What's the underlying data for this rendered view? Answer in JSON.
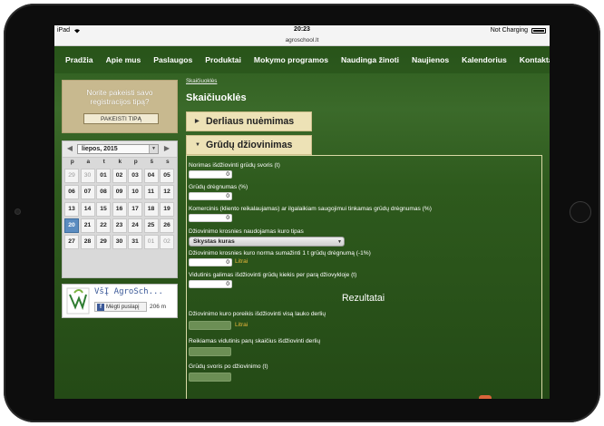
{
  "status_bar": {
    "device": "iPad",
    "time": "20:23",
    "battery": "Not Charging",
    "url": "agroschool.lt"
  },
  "nav": {
    "items": [
      "Pradžia",
      "Apie mus",
      "Paslaugos",
      "Produktai",
      "Mokymo programos",
      "Naudinga žinoti",
      "Naujienos",
      "Kalendorius",
      "Kontaktai"
    ]
  },
  "promo": {
    "text_line1": "Norite pakeisti savo",
    "text_line2": "registracijos tipą?",
    "button": "PAKEISTI TIPĄ"
  },
  "calendar": {
    "month": "liepos, 2015",
    "dow": [
      "p",
      "a",
      "t",
      "k",
      "p",
      "š",
      "s"
    ],
    "weeks": [
      [
        "29",
        "30",
        "01",
        "02",
        "03",
        "04",
        "05"
      ],
      [
        "06",
        "07",
        "08",
        "09",
        "10",
        "11",
        "12"
      ],
      [
        "13",
        "14",
        "15",
        "16",
        "17",
        "18",
        "19"
      ],
      [
        "20",
        "21",
        "22",
        "23",
        "24",
        "25",
        "26"
      ],
      [
        "27",
        "28",
        "29",
        "30",
        "31",
        "01",
        "02"
      ]
    ],
    "today": "20"
  },
  "facebook": {
    "name": "VšĮ AgroSch...",
    "like_label": "Mėgti puslapį",
    "count": "206 m"
  },
  "content": {
    "breadcrumb": "Skaičiuoklės",
    "title": "Skaičiuoklės",
    "accordion": [
      {
        "label": "Derliaus nuėmimas"
      },
      {
        "label": "Grūdų džiovinimas"
      }
    ],
    "form": {
      "field1_label": "Norimas išdžiovinti grūdų svoris (t)",
      "field1_value": "0",
      "field2_label": "Grūdų drėgnumas (%)",
      "field2_value": "0",
      "field3_label": "Komercinis (kliento reikalaujamas) ar ilgalaikiam saugojimui tinkamas grūdų drėgnumas (%)",
      "field3_value": "0",
      "field4_label": "Džiovinimo krosnies naudojamas kuro tipas",
      "field4_value": "Skystas kuras",
      "field5_label": "Džiovinimo krosnies kuro norma sumažinti 1 t grūdų drėgnumą (-1%)",
      "field5_value": "0",
      "field5_unit": "Litrai",
      "field6_label": "Vidutinis galimas išdžiovinti grūdų kiekis per parą džiovyklojе (t)",
      "field6_value": "0"
    },
    "results": {
      "title": "Rezultatai",
      "res1_label": "Džiovinimo kuro poreikis išdžiovinti visą lauko derlių",
      "res1_unit": "Litrai",
      "res2_label": "Reikiamas vidutinis parų skaičius išdžiovinti derlių",
      "res3_label": "Grūdų svoris po džiovinimo (t)"
    }
  }
}
